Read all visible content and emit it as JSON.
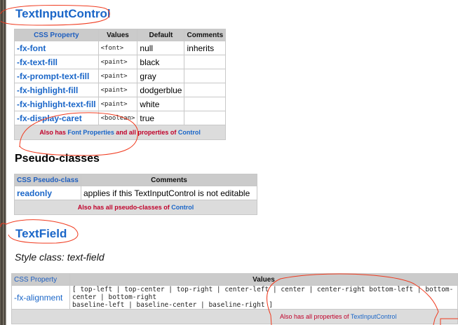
{
  "section1": {
    "title": "TextInputControl",
    "headers": [
      "CSS Property",
      "Values",
      "Default",
      "Comments"
    ],
    "rows": [
      {
        "property": "-fx-font",
        "values": "<font>",
        "default": "null",
        "comments": "inherits"
      },
      {
        "property": "-fx-text-fill",
        "values": "<paint>",
        "default": "black",
        "comments": ""
      },
      {
        "property": "-fx-prompt-text-fill",
        "values": "<paint>",
        "default": "gray",
        "comments": ""
      },
      {
        "property": "-fx-highlight-fill",
        "values": "<paint>",
        "default": "dodgerblue",
        "comments": ""
      },
      {
        "property": "-fx-highlight-text-fill",
        "values": "<paint>",
        "default": "white",
        "comments": ""
      },
      {
        "property": "-fx-display-caret",
        "values": "<boolean>",
        "default": "true",
        "comments": ""
      }
    ],
    "footer": {
      "prefix": "Also has ",
      "link1": "Font Properties",
      "middle": " and all properties of ",
      "link2": "Control"
    }
  },
  "pseudo": {
    "title": "Pseudo-classes",
    "headers": [
      "CSS Pseudo-class",
      "Comments"
    ],
    "rows": [
      {
        "name": "readonly",
        "comments": "applies if this TextInputControl is not editable"
      }
    ],
    "footer": {
      "prefix": "Also has all pseudo-classes of ",
      "link": "Control"
    }
  },
  "section2": {
    "title": "TextField",
    "style_class": "Style class: text-field",
    "headers": [
      "CSS Property",
      "Values"
    ],
    "rows": [
      {
        "property": "-fx-alignment",
        "values_line1": "[ top-left | top-center | top-right | center-left | center | center-right bottom-left | bottom-center | bottom-right",
        "values_line2": "baseline-left | baseline-center | baseline-right ]"
      }
    ],
    "footer": {
      "prefix": "Also has all properties of ",
      "link": "TextInputControl"
    }
  }
}
